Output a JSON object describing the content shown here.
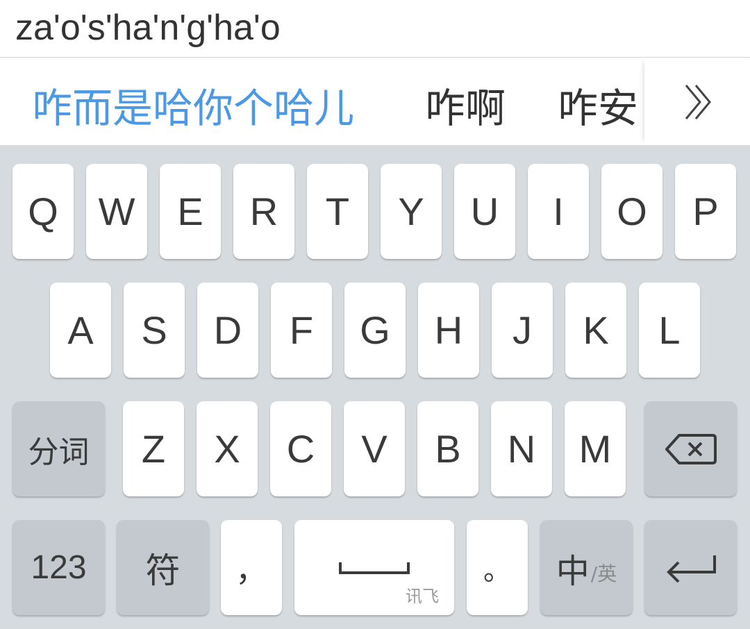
{
  "composition": {
    "text": "za'o's'ha'n'g'ha'o"
  },
  "candidates": {
    "first": "咋而是哈你个哈儿",
    "second": "咋啊",
    "third": "咋安",
    "more_icon": "double-chevron-right-icon"
  },
  "keyboard": {
    "row1": [
      "Q",
      "W",
      "E",
      "R",
      "T",
      "Y",
      "U",
      "I",
      "O",
      "P"
    ],
    "row2": [
      "A",
      "S",
      "D",
      "F",
      "G",
      "H",
      "J",
      "K",
      "L"
    ],
    "row3": [
      "Z",
      "X",
      "C",
      "V",
      "B",
      "N",
      "M"
    ],
    "segment_label": "分词",
    "backspace_icon": "backspace-icon",
    "num_label": "123",
    "symbol_label": "符",
    "comma_label": "，",
    "space_sub_label": "讯飞",
    "period_label": "。",
    "lang_primary": "中",
    "lang_secondary": "/英",
    "enter_icon": "enter-icon"
  },
  "colors": {
    "accent": "#4a98e6",
    "keyboard_bg": "#d6dbdf",
    "function_key": "#c3c9ce",
    "key_text": "#3a3a3a"
  }
}
